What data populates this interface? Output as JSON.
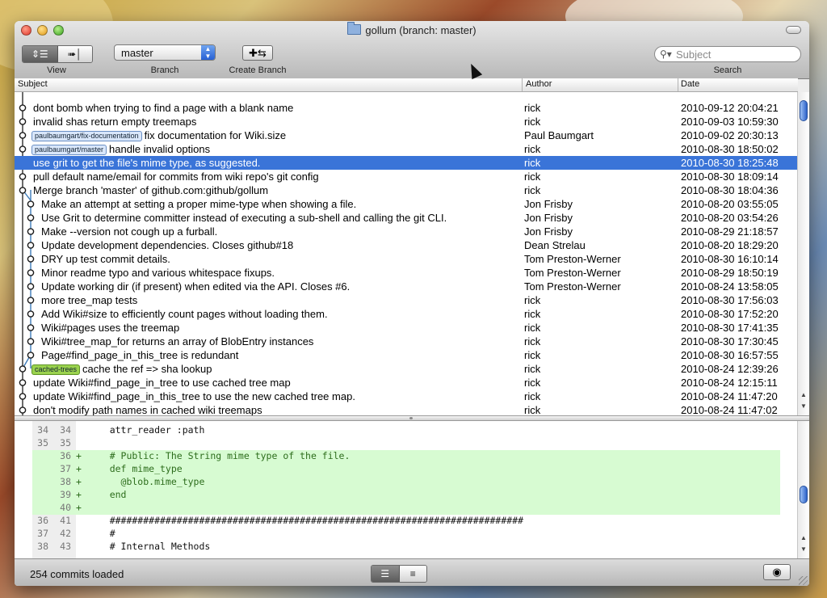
{
  "window": {
    "title": "gollum (branch: master)"
  },
  "toolbar": {
    "view_label": "View",
    "branch_label": "Branch",
    "branch_value": "master",
    "create_branch_label": "Create Branch",
    "search_label": "Search",
    "search_placeholder": "Subject"
  },
  "columns": {
    "subject": "Subject",
    "author": "Author",
    "date": "Date"
  },
  "commits": [
    {
      "subject": "dont bomb when trying to find a page with a blank name",
      "author": "rick",
      "date": "2010-09-12 20:04:21",
      "tag": ""
    },
    {
      "subject": "invalid shas return empty treemaps",
      "author": "rick",
      "date": "2010-09-03 10:59:30",
      "tag": ""
    },
    {
      "subject": "fix documentation for Wiki.size",
      "author": "Paul Baumgart",
      "date": "2010-09-02 20:30:13",
      "tag": "paulbaumgart/fix-documentation"
    },
    {
      "subject": "handle invalid options",
      "author": "rick",
      "date": "2010-08-30 18:50:02",
      "tag": "paulbaumgart/master"
    },
    {
      "subject": "use grit to get the file's mime type, as suggested.",
      "author": "rick",
      "date": "2010-08-30 18:25:48",
      "tag": ""
    },
    {
      "subject": "pull default name/email for commits from wiki repo's git config",
      "author": "rick",
      "date": "2010-08-30 18:09:14",
      "tag": ""
    },
    {
      "subject": "Merge branch 'master' of github.com:github/gollum",
      "author": "rick",
      "date": "2010-08-30 18:04:36",
      "tag": ""
    },
    {
      "subject": "Make an attempt at setting a proper mime-type when showing a file.",
      "author": "Jon Frisby",
      "date": "2010-08-20 03:55:05",
      "tag": ""
    },
    {
      "subject": "Use Grit to determine committer instead of executing a sub-shell and calling the git CLI.",
      "author": "Jon Frisby",
      "date": "2010-08-20 03:54:26",
      "tag": ""
    },
    {
      "subject": "Make --version not cough up a furball.",
      "author": "Jon Frisby",
      "date": "2010-08-29 21:18:57",
      "tag": ""
    },
    {
      "subject": "Update development dependencies. Closes github#18",
      "author": "Dean Strelau",
      "date": "2010-08-20 18:29:20",
      "tag": ""
    },
    {
      "subject": "DRY up test commit details.",
      "author": "Tom Preston-Werner",
      "date": "2010-08-30 16:10:14",
      "tag": ""
    },
    {
      "subject": "Minor readme typo and various whitespace fixups.",
      "author": "Tom Preston-Werner",
      "date": "2010-08-29 18:50:19",
      "tag": ""
    },
    {
      "subject": "Update working dir (if present) when edited via the API. Closes #6.",
      "author": "Tom Preston-Werner",
      "date": "2010-08-24 13:58:05",
      "tag": ""
    },
    {
      "subject": "more tree_map tests",
      "author": "rick",
      "date": "2010-08-30 17:56:03",
      "tag": ""
    },
    {
      "subject": "Add Wiki#size to efficiently count pages without loading them.",
      "author": "rick",
      "date": "2010-08-30 17:52:20",
      "tag": ""
    },
    {
      "subject": "Wiki#pages uses the treemap",
      "author": "rick",
      "date": "2010-08-30 17:41:35",
      "tag": ""
    },
    {
      "subject": "Wiki#tree_map_for returns an array of BlobEntry instances",
      "author": "rick",
      "date": "2010-08-30 17:30:45",
      "tag": ""
    },
    {
      "subject": "Page#find_page_in_this_tree is redundant",
      "author": "rick",
      "date": "2010-08-30 16:57:55",
      "tag": ""
    },
    {
      "subject": "cache the ref => sha lookup",
      "author": "rick",
      "date": "2010-08-24 12:39:26",
      "tag": "cached-trees"
    },
    {
      "subject": "update Wiki#find_page_in_tree to use cached tree map",
      "author": "rick",
      "date": "2010-08-24 12:15:11",
      "tag": ""
    },
    {
      "subject": "update Wiki#find_page_in_this_tree to use the new cached tree map.",
      "author": "rick",
      "date": "2010-08-24 11:47:20",
      "tag": ""
    },
    {
      "subject": "don't modify path names in cached wiki treemaps",
      "author": "rick",
      "date": "2010-08-24 11:47:02",
      "tag": ""
    }
  ],
  "diff": [
    {
      "old": "34",
      "new": "34",
      "sign": " ",
      "code": "    attr_reader :path",
      "type": "ctx"
    },
    {
      "old": "35",
      "new": "35",
      "sign": " ",
      "code": "",
      "type": "ctx"
    },
    {
      "old": "",
      "new": "36",
      "sign": "+",
      "code": "    # Public: The String mime type of the file.",
      "type": "add"
    },
    {
      "old": "",
      "new": "37",
      "sign": "+",
      "code": "    def mime_type",
      "type": "add"
    },
    {
      "old": "",
      "new": "38",
      "sign": "+",
      "code": "      @blob.mime_type",
      "type": "add"
    },
    {
      "old": "",
      "new": "39",
      "sign": "+",
      "code": "    end",
      "type": "add"
    },
    {
      "old": "",
      "new": "40",
      "sign": "+",
      "code": "",
      "type": "add"
    },
    {
      "old": "36",
      "new": "41",
      "sign": " ",
      "code": "    ##########################################################################",
      "type": "ctx"
    },
    {
      "old": "37",
      "new": "42",
      "sign": " ",
      "code": "    #",
      "type": "ctx"
    },
    {
      "old": "38",
      "new": "43",
      "sign": " ",
      "code": "    # Internal Methods",
      "type": "ctx"
    }
  ],
  "status": {
    "text": "254 commits loaded"
  },
  "colors": {
    "selection": "#3a74d8",
    "added_bg": "#d7fbd2",
    "tag_blue": "#d8e6fa",
    "tag_green": "#9ad24e"
  }
}
